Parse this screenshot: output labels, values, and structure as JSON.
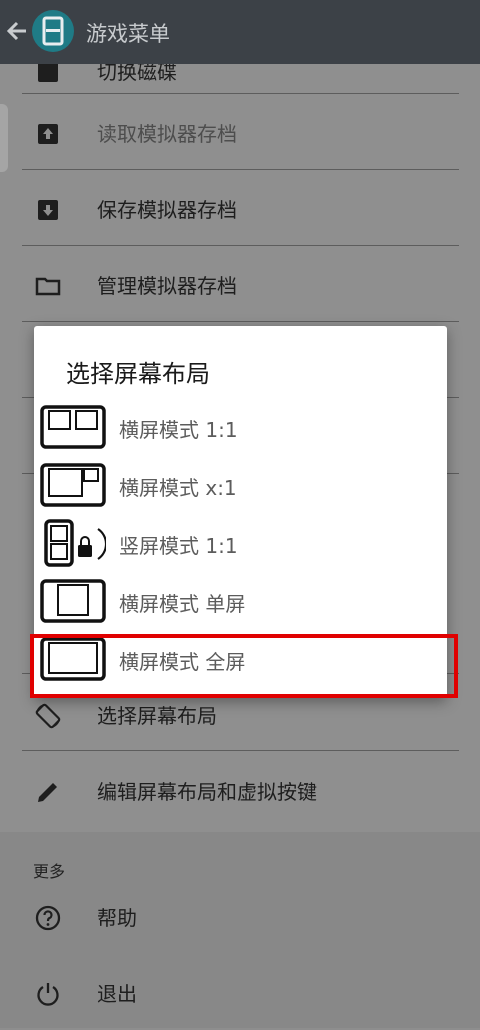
{
  "header": {
    "title": "游戏菜单"
  },
  "menu": {
    "items": [
      {
        "label": "切换磁碟",
        "icon": "disc-icon"
      },
      {
        "label": "读取模拟器存档",
        "icon": "load-state-icon"
      },
      {
        "label": "保存模拟器存档",
        "icon": "save-state-icon"
      },
      {
        "label": "管理模拟器存档",
        "icon": "folder-icon"
      },
      {
        "label": "选择屏幕布局",
        "icon": "screen-rotation-icon"
      },
      {
        "label": "编辑屏幕布局和虚拟按键",
        "icon": "pencil-icon"
      }
    ]
  },
  "more": {
    "label": "更多",
    "items": [
      {
        "label": "帮助",
        "icon": "help-icon"
      },
      {
        "label": "退出",
        "icon": "power-icon"
      }
    ]
  },
  "dialog": {
    "title": "选择屏幕布局",
    "options": [
      {
        "label": "横屏模式 1:1",
        "icon": "landscape-1-1-layout-icon"
      },
      {
        "label": "横屏模式 x:1",
        "icon": "landscape-x-1-layout-icon"
      },
      {
        "label": "竖屏模式 1:1",
        "icon": "portrait-locked-layout-icon"
      },
      {
        "label": "横屏模式 单屏",
        "icon": "landscape-single-layout-icon"
      },
      {
        "label": "横屏模式 全屏",
        "icon": "landscape-fullscreen-layout-icon"
      }
    ],
    "highlighted_index": 4,
    "highlight_color": "#e00000"
  },
  "colors": {
    "header_bg": "#3c4147",
    "app_icon_bg": "#1f7b86",
    "scrim_bg": "#8e8e8e"
  }
}
